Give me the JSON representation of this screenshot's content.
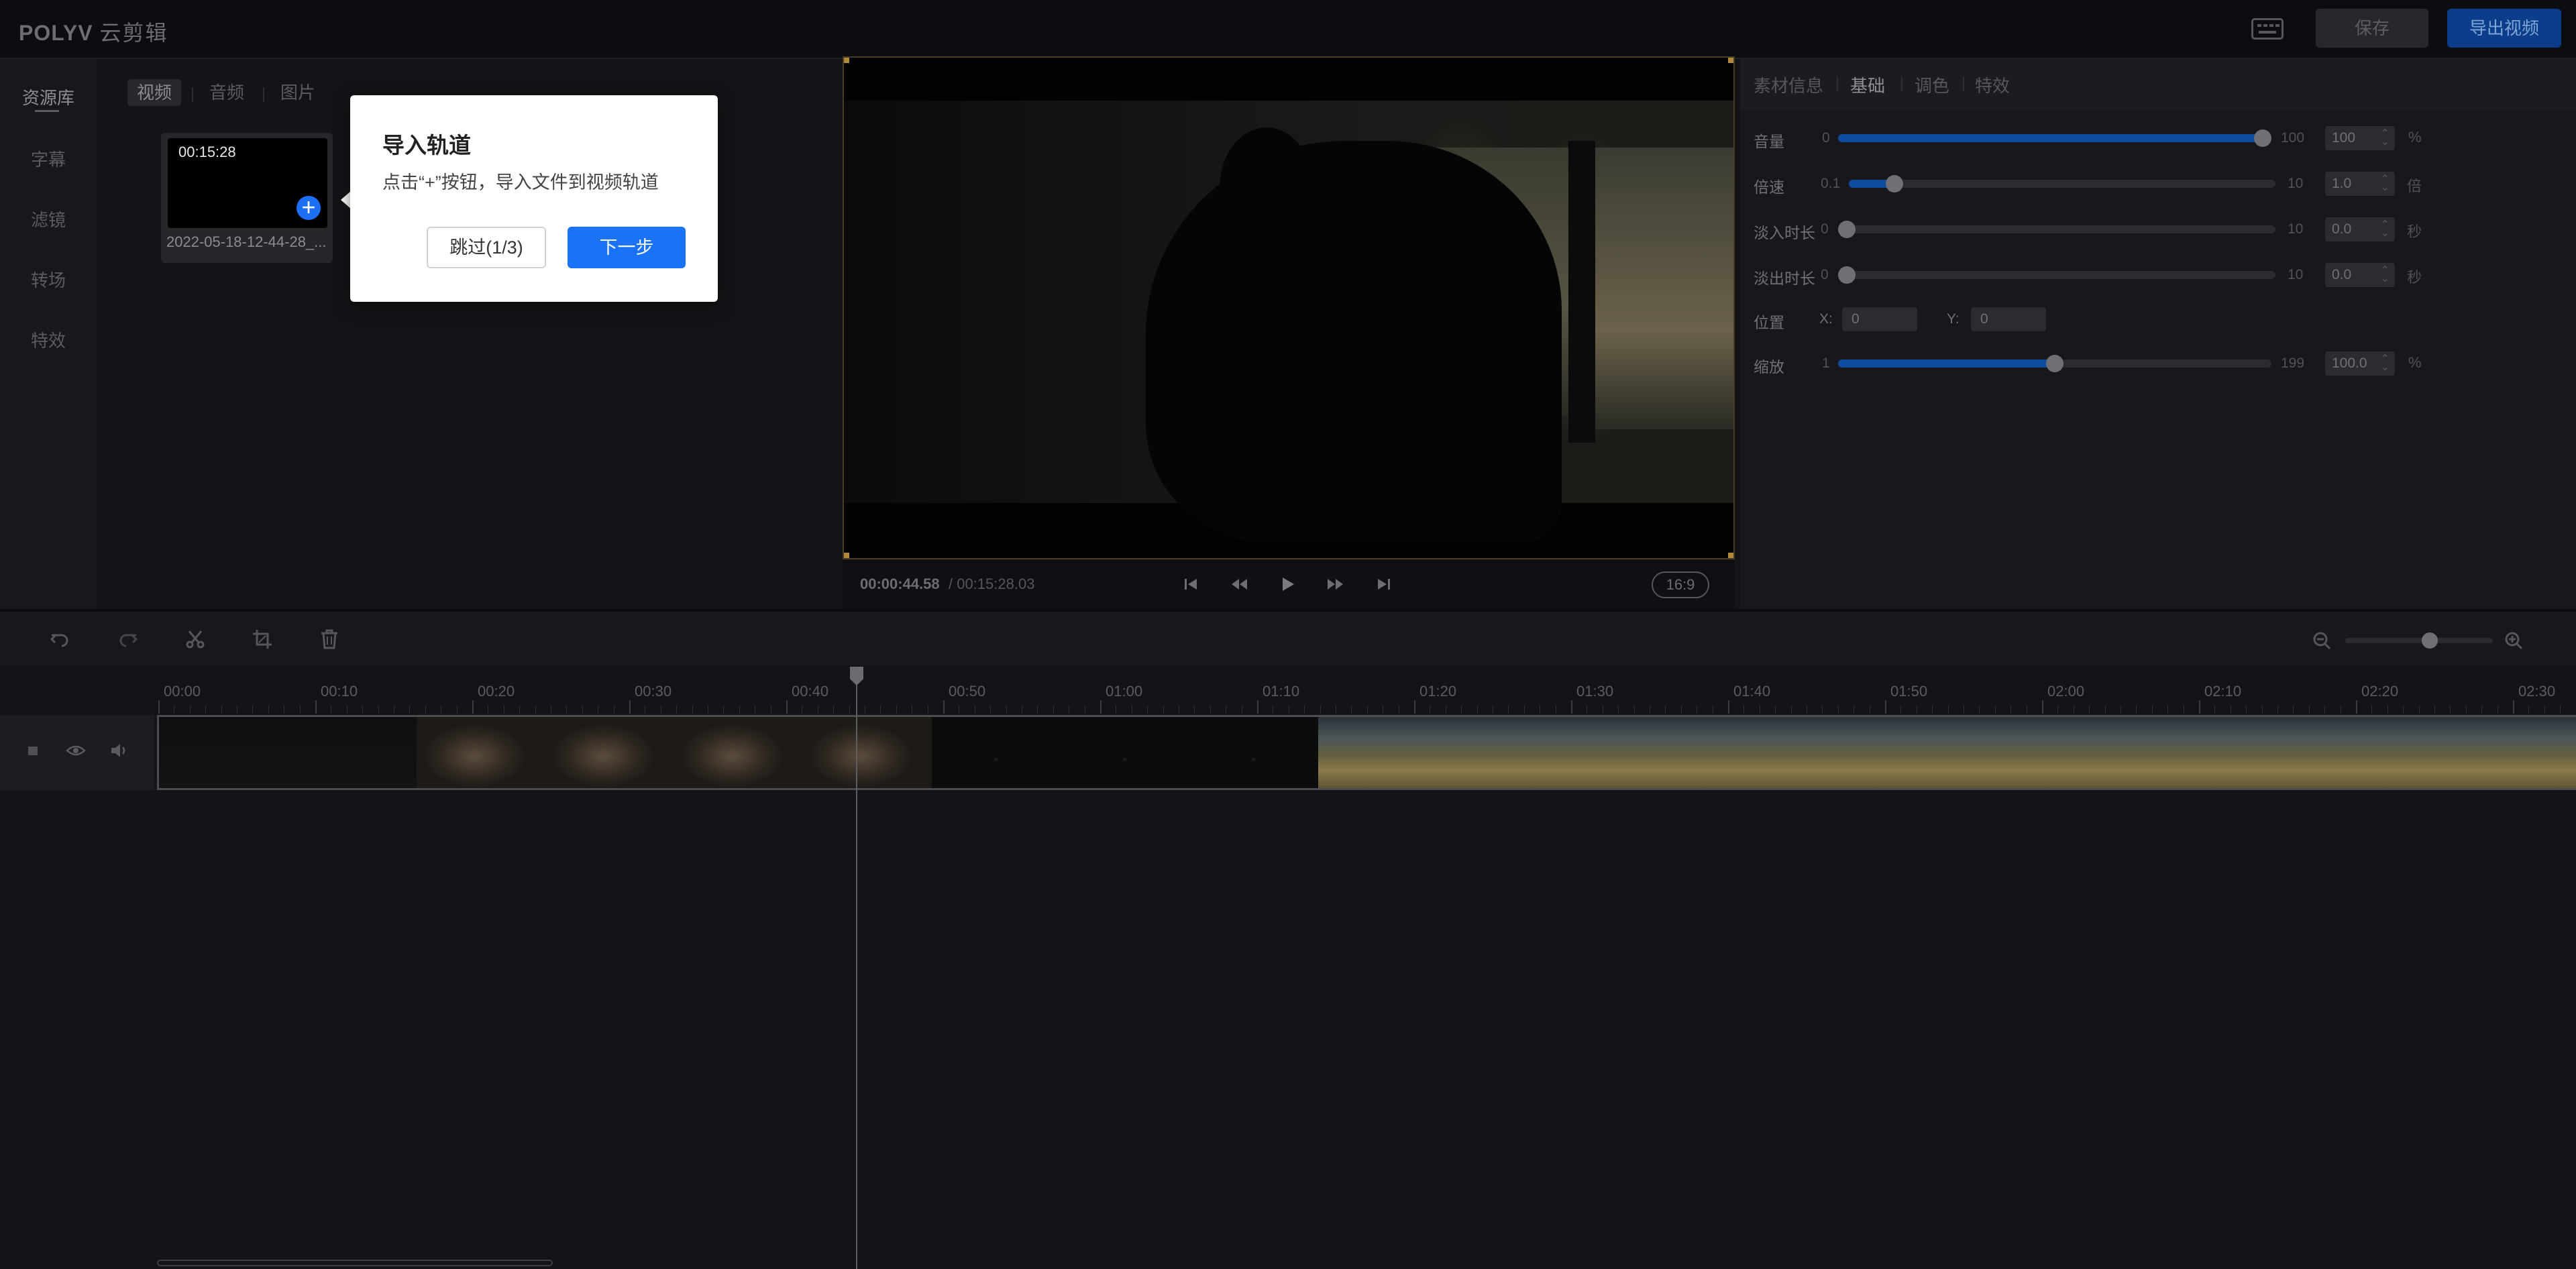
{
  "header": {
    "logo_brand": "POLYV",
    "logo_product": "云剪辑",
    "keyboard_icon": "keyboard-icon",
    "save_label": "保存",
    "export_label": "导出视频",
    "colors": {
      "export_bg": "#0c3d8a",
      "accent": "#1a73f5"
    }
  },
  "left_nav": {
    "items": [
      {
        "label": "资源库",
        "active": true
      },
      {
        "label": "字幕"
      },
      {
        "label": "滤镜"
      },
      {
        "label": "转场"
      },
      {
        "label": "特效"
      }
    ]
  },
  "resource_panel": {
    "tabs": [
      {
        "label": "视频",
        "active": true
      },
      {
        "label": "音频"
      },
      {
        "label": "图片"
      }
    ],
    "clip": {
      "duration": "00:15:28",
      "name": "2022-05-18-12-44-28_...",
      "add_icon": "plus-circle-icon"
    }
  },
  "onboarding": {
    "title": "导入轨道",
    "description": "点击“+”按钮，导入文件到视频轨道",
    "skip_label": "跳过(1/3)",
    "next_label": "下一步"
  },
  "preview": {
    "current_time": "00:00:44.58",
    "total_time": "/ 00:15:28.03",
    "controls": [
      "skip-start-icon",
      "rewind-icon",
      "play-icon",
      "fast-forward-icon",
      "skip-end-icon"
    ],
    "aspect_ratio": "16:9"
  },
  "properties": {
    "tabs": [
      {
        "label": "素材信息"
      },
      {
        "label": "基础",
        "active": true
      },
      {
        "label": "调色"
      },
      {
        "label": "特效"
      }
    ],
    "volume": {
      "label": "音量",
      "min": "0",
      "max": "100",
      "value": "100",
      "unit": "%",
      "level": 1.0
    },
    "speed": {
      "label": "倍速",
      "min": "0.1",
      "max": "10",
      "value": "1.0",
      "unit": "倍",
      "level": 0.09
    },
    "fade_in": {
      "label": "淡入时长",
      "min": "0",
      "max": "10",
      "value": "0.0",
      "unit": "秒",
      "level": 0.0
    },
    "fade_out": {
      "label": "淡出时长",
      "min": "0",
      "max": "10",
      "value": "0.0",
      "unit": "秒",
      "level": 0.0
    },
    "position": {
      "label": "位置",
      "x_label": "X:",
      "x_value": "0",
      "y_label": "Y:",
      "y_value": "0"
    },
    "scale": {
      "label": "缩放",
      "min": "1",
      "max": "199",
      "value": "100.0",
      "unit": "%",
      "level": 0.5
    }
  },
  "timeline": {
    "tools": [
      "undo-icon",
      "redo-icon",
      "scissors-icon",
      "crop-icon",
      "trash-icon"
    ],
    "zoom": {
      "out_icon": "zoom-out-icon",
      "in_icon": "zoom-in-icon",
      "level": 0.5
    },
    "ruler_labels": [
      "00:00",
      "00:10",
      "00:20",
      "00:30",
      "00:40",
      "00:50",
      "01:00",
      "01:10",
      "01:20",
      "01:30",
      "01:40",
      "01:50",
      "02:00",
      "02:10",
      "02:20",
      "02:30"
    ],
    "track_icons": [
      "track-lock-icon",
      "eye-icon",
      "speaker-icon"
    ],
    "playhead_time": "00:44.58"
  }
}
